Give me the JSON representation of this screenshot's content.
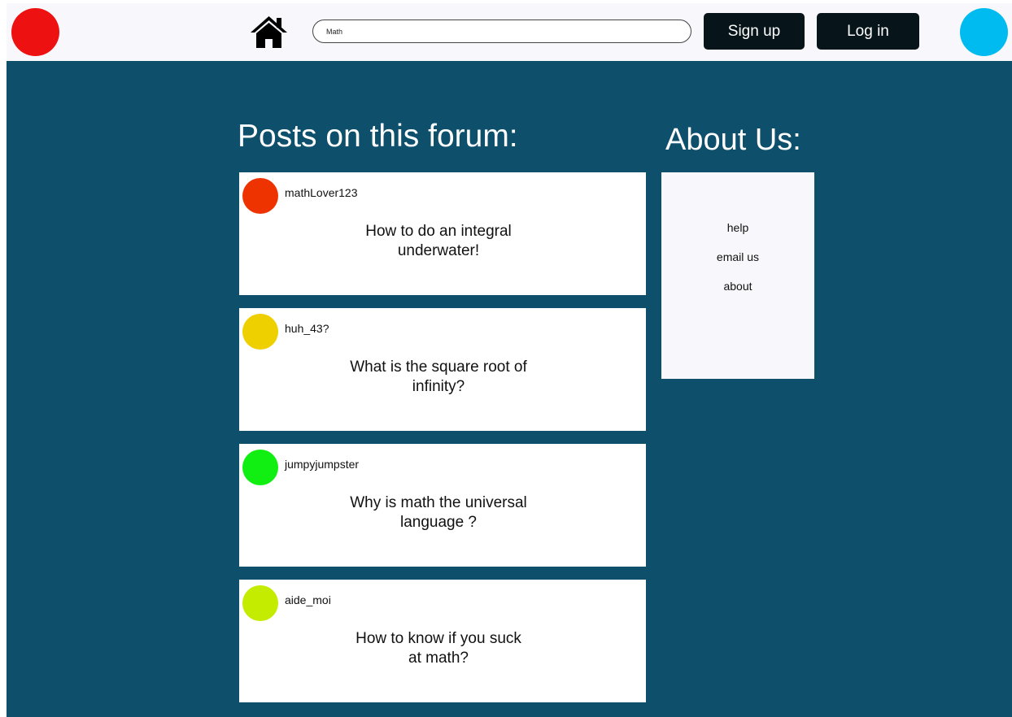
{
  "colors": {
    "page_bg": "#0e4f6b",
    "header_bg": "#f8f8fc",
    "button_bg": "#07141a",
    "logo_dot": "#ee1111",
    "profile_dot": "#00bbf0"
  },
  "header": {
    "logo_icon": "red-circle-logo",
    "home_icon": "home-icon",
    "search": {
      "value": "Math",
      "placeholder": ""
    },
    "signup_label": "Sign up",
    "login_label": "Log in",
    "profile_icon": "profile-avatar-icon"
  },
  "posts_section": {
    "heading": "Posts on this forum:",
    "posts": [
      {
        "username": "mathLover123",
        "title": "How to do an integral\nunderwater!",
        "avatar_color": "#ee3300"
      },
      {
        "username": "huh_43?",
        "title": "What is the square root of\ninfinity?",
        "avatar_color": "#eed000"
      },
      {
        "username": "jumpyjumpster",
        "title": "Why is math the universal\nlanguage ?",
        "avatar_color": "#11ee11"
      },
      {
        "username": "aide_moi",
        "title": "How to know if you suck\nat math?",
        "avatar_color": "#c4ec00"
      }
    ]
  },
  "about_section": {
    "heading": "About Us:",
    "links": [
      "help",
      "email us",
      "about"
    ]
  }
}
